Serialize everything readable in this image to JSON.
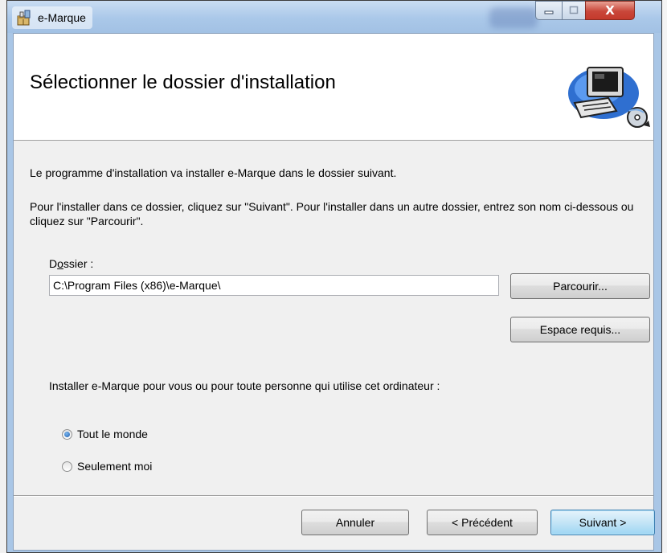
{
  "window": {
    "title": "e-Marque",
    "close_glyph": "X",
    "icons": {
      "app": "installer-package-icon",
      "min": "minimize-icon",
      "max": "maximize-icon",
      "close": "close-icon"
    }
  },
  "banner": {
    "title": "Sélectionner le dossier d'installation",
    "art_icon": "computer-disc-icon"
  },
  "content": {
    "intro": "Le programme d'installation va installer e-Marque dans le dossier suivant.",
    "instructions": "Pour l'installer dans ce dossier, cliquez sur \"Suivant\". Pour l'installer dans un autre dossier, entrez son nom ci-dessous ou cliquez sur \"Parcourir\".",
    "folder_label_pre": "D",
    "folder_label_accel": "o",
    "folder_label_post": "ssier :",
    "folder_value": "C:\\Program Files (x86)\\e-Marque\\",
    "browse_label": "Parcourir...",
    "disk_cost_label": "Espace requis...",
    "install_for_text": "Installer e-Marque pour vous ou pour toute personne qui utilise cet ordinateur :",
    "radio_everyone": "Tout le monde",
    "radio_just_me": "Seulement moi",
    "selected": "everyone"
  },
  "footer": {
    "cancel_label": "Annuler",
    "back_label": "< Précédent",
    "next_label": "Suivant >"
  },
  "colors": {
    "titlebar": "#aac8e9",
    "client": "#f0f0f0",
    "close": "#c9473a",
    "default_button": "#c4e5f6"
  }
}
